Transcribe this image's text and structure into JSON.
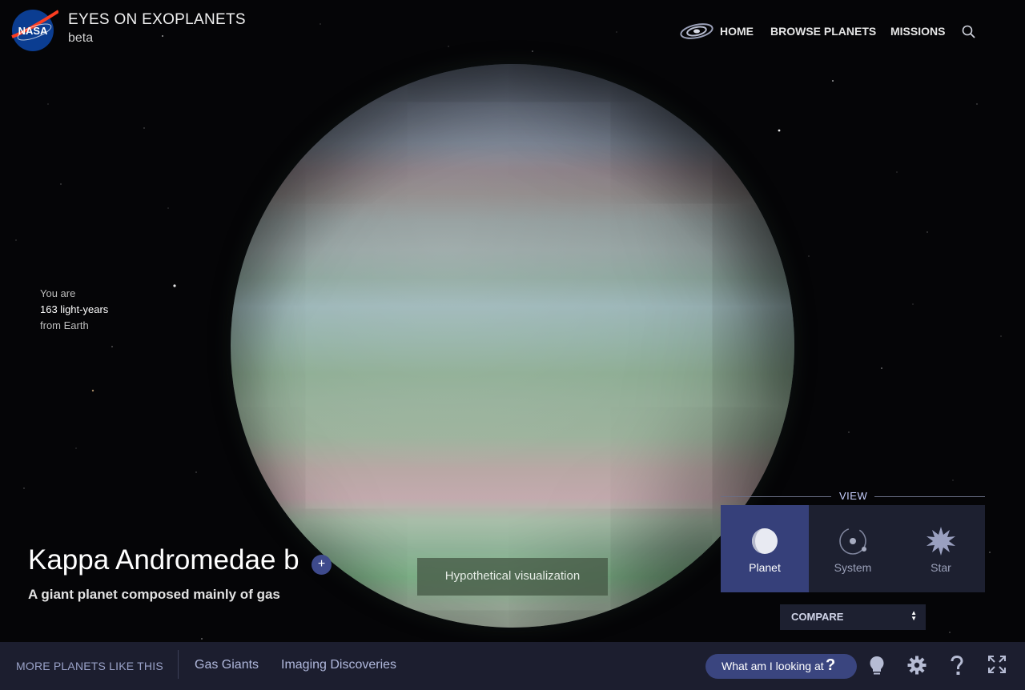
{
  "header": {
    "title": "EYES ON EXOPLANETS",
    "subtitle": "beta",
    "logo_text": "NASA",
    "nav": [
      {
        "label": "HOME"
      },
      {
        "label": "BROWSE PLANETS"
      },
      {
        "label": "MISSIONS"
      }
    ],
    "icons": [
      "galaxy-icon",
      "search-icon"
    ]
  },
  "distance": {
    "line1": "You are",
    "line2": "163 light-years",
    "line3": "from Earth"
  },
  "planet": {
    "name": "Kappa Andromedae b",
    "add_label": "+",
    "description": "A giant planet composed mainly of gas",
    "visualization_note": "Hypothetical visualization"
  },
  "view": {
    "label": "VIEW",
    "options": [
      {
        "label": "Planet",
        "icon": "planet-icon",
        "active": true
      },
      {
        "label": "System",
        "icon": "system-icon",
        "active": false
      },
      {
        "label": "Star",
        "icon": "star-icon",
        "active": false
      }
    ],
    "compare_label": "COMPARE"
  },
  "bottom_bar": {
    "more_label": "MORE PLANETS LIKE THIS",
    "links": [
      {
        "label": "Gas Giants"
      },
      {
        "label": "Imaging Discoveries"
      }
    ],
    "what_label": "What am I looking at",
    "what_icon": "?",
    "icons": [
      "lightbulb-icon",
      "gear-icon",
      "help-icon",
      "fullscreen-icon"
    ]
  },
  "colors": {
    "accent": "#3a457f",
    "view_active": "#36407a",
    "panel_bg": "#1d2030",
    "bar_bg": "#1c1e2f"
  }
}
